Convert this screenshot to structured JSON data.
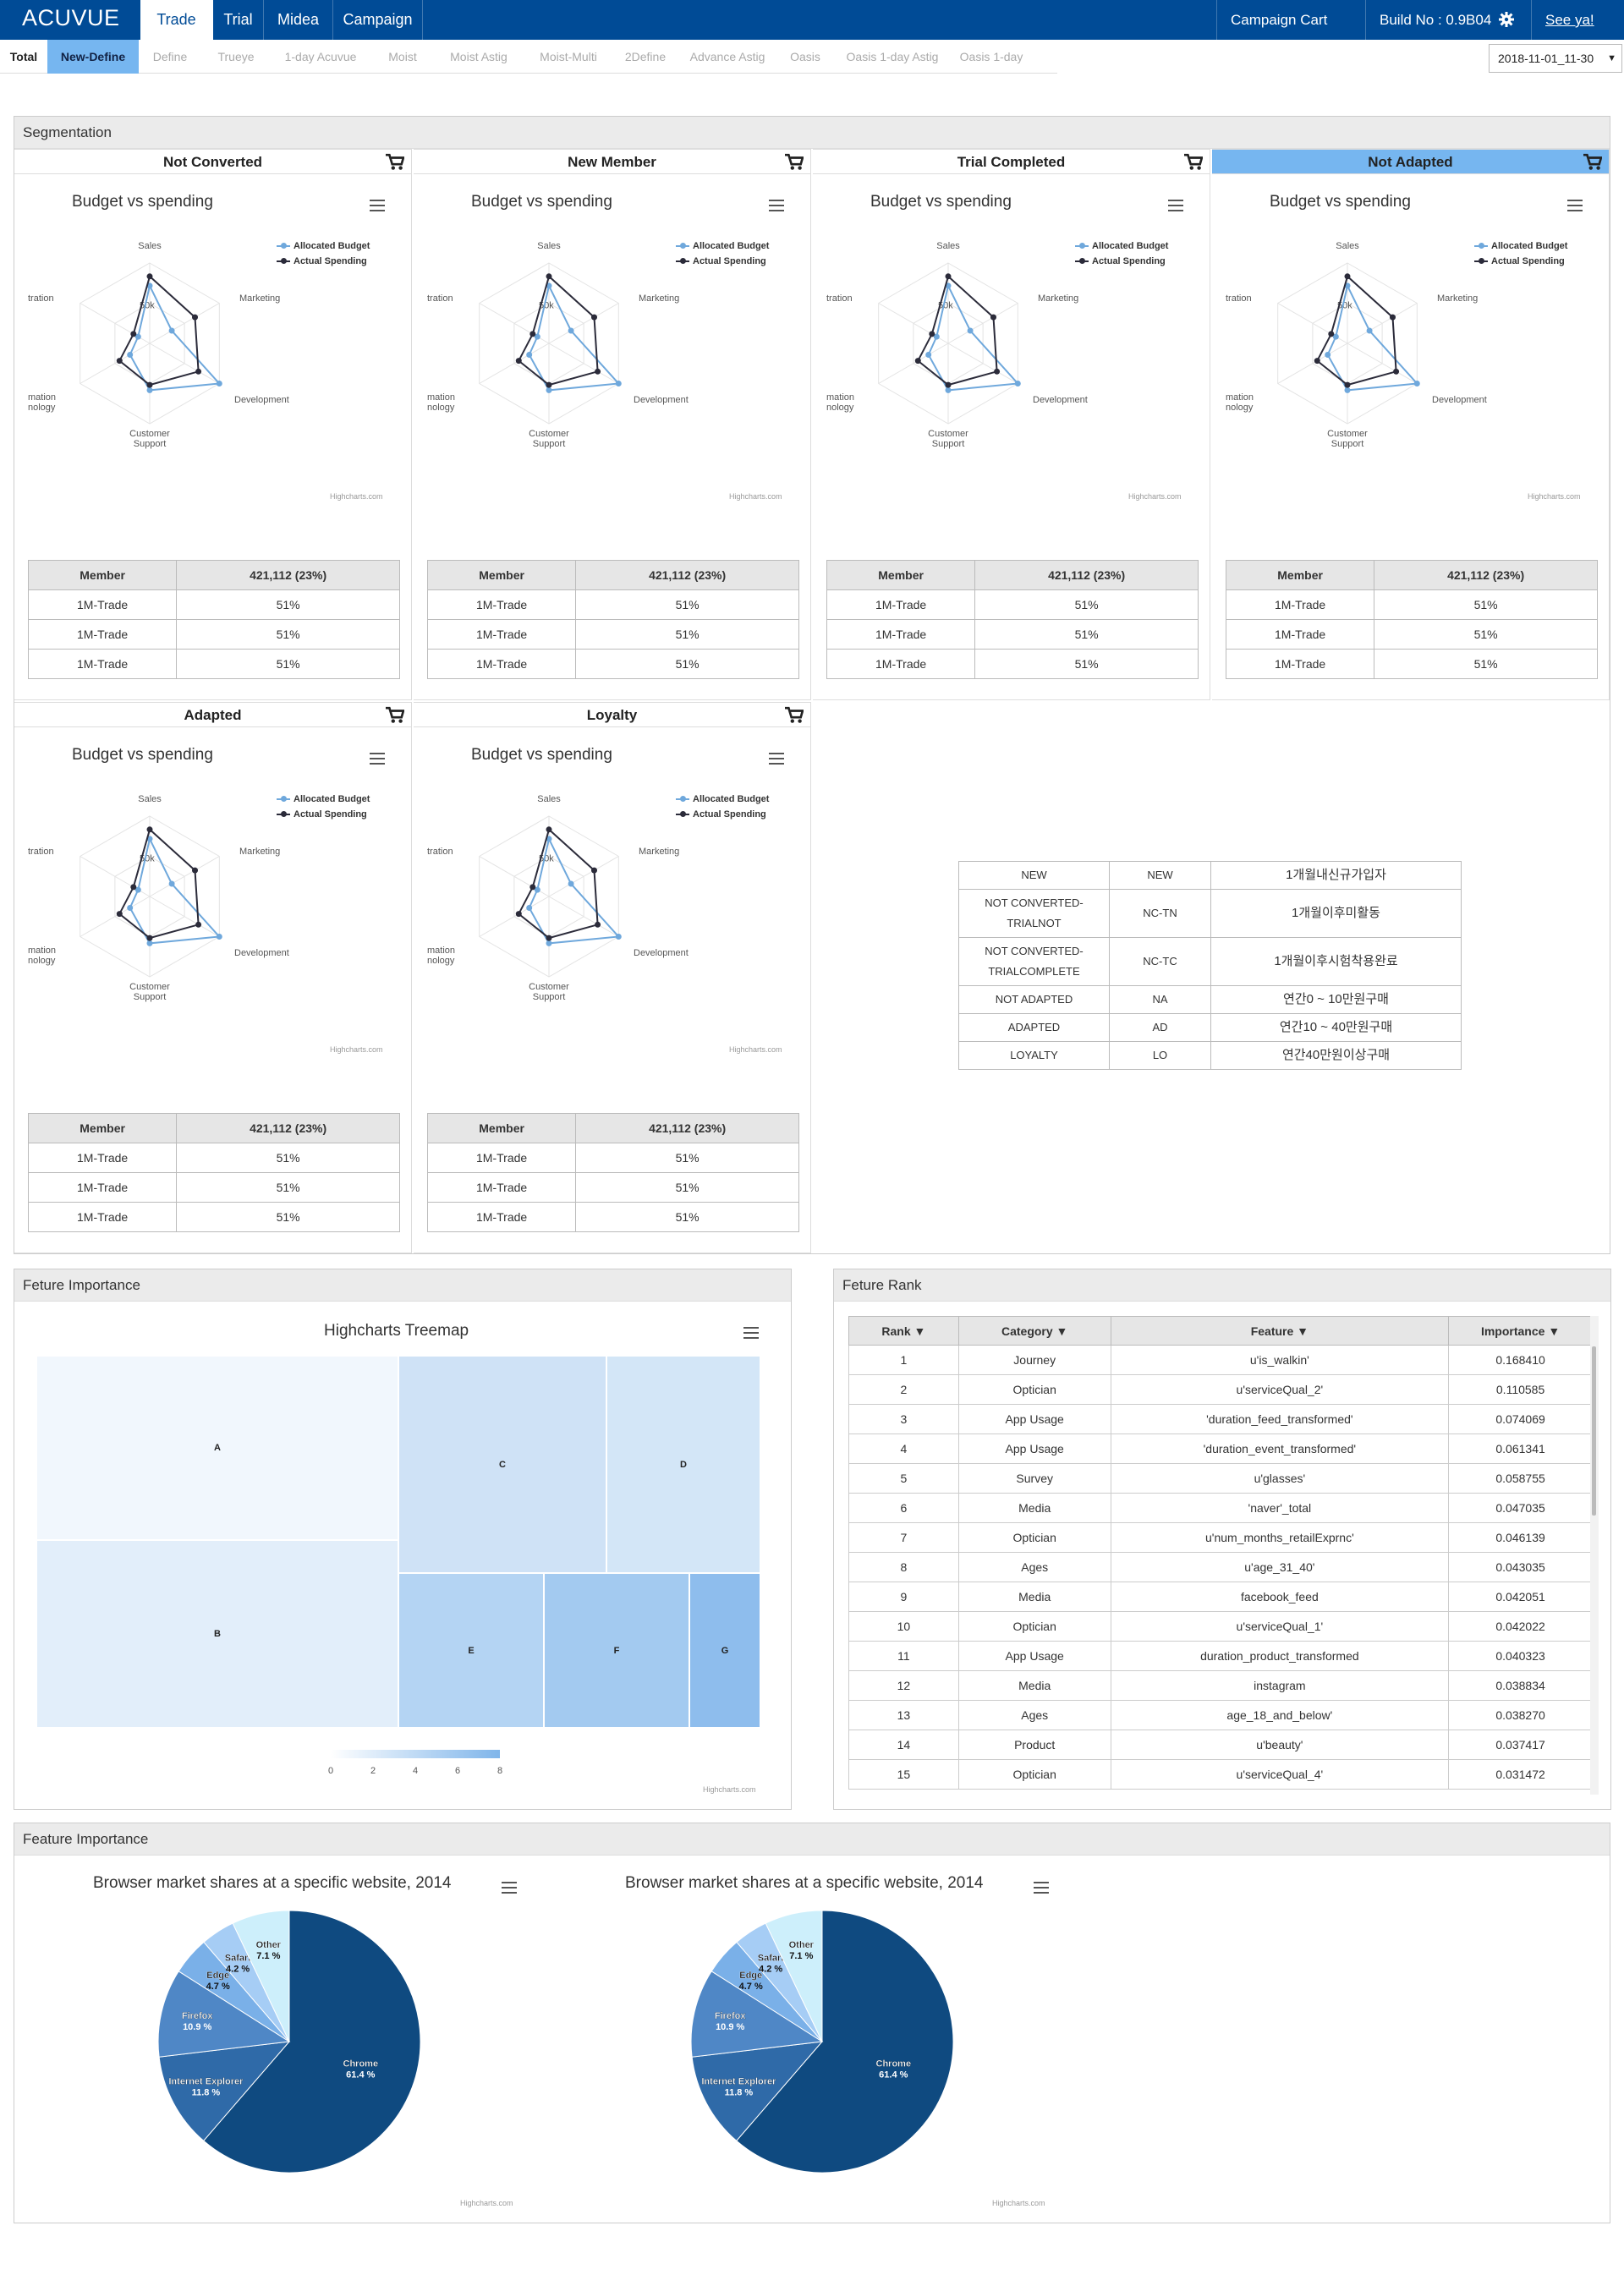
{
  "app": {
    "logo": "ACUVUE",
    "tabs": [
      "Trade",
      "Trial",
      "Midea",
      "Campaign"
    ],
    "active_tab": "Trade",
    "campaign_cart": "Campaign Cart",
    "build": "Build No : 0.9B04",
    "user": "See ya!"
  },
  "subnav": {
    "items": [
      "Total",
      "New-Define",
      "Define",
      "Trueye",
      "1-day Acuvue",
      "Moist",
      "Moist Astig",
      "Moist-Multi",
      "2Define",
      "Advance Astig",
      "Oasis",
      "Oasis 1-day Astig",
      "Oasis 1-day"
    ],
    "active": "New-Define",
    "date": "2018-11-01_11-30"
  },
  "segmentation": {
    "title": "Segmentation",
    "chart_title": "Budget vs spending",
    "legend": [
      "Allocated Budget",
      "Actual Spending"
    ],
    "axes": [
      "Sales",
      "Marketing",
      "Development",
      "Customer Support",
      "Information Technology",
      "Administration"
    ],
    "axis_label_lines": {
      "sales": "Sales",
      "marketing": "Marketing",
      "development": "Development",
      "cs1": "Customer",
      "cs2": "Support",
      "it1": "mation",
      "it2": "nology",
      "admin": "tration"
    },
    "tick": "50k",
    "credits": "Highcharts.com",
    "table_header": [
      "Member",
      "421,112 (23%)"
    ],
    "table_rows": [
      [
        "1M-Trade",
        "51%"
      ],
      [
        "1M-Trade",
        "51%"
      ],
      [
        "1M-Trade",
        "51%"
      ]
    ],
    "segments": [
      {
        "name": "Not Converted",
        "selected": false
      },
      {
        "name": "New Member",
        "selected": false
      },
      {
        "name": "Trial Completed",
        "selected": false
      },
      {
        "name": "Not Adapted",
        "selected": true
      },
      {
        "name": "Adapted",
        "selected": false
      },
      {
        "name": "Loyalty",
        "selected": false
      }
    ],
    "codes": [
      [
        "NEW",
        "NEW",
        "1개월내신규가입자"
      ],
      [
        "NOT CONVERTED-\nTRIALNOT",
        "NC-TN",
        "1개월이후미활동"
      ],
      [
        "NOT CONVERTED-\nTRIALCOMPLETE",
        "NC-TC",
        "1개월이후시험착용완료"
      ],
      [
        "NOT ADAPTED",
        "NA",
        "연간0 ~ 10만원구매"
      ],
      [
        "ADAPTED",
        "AD",
        "연간10 ~ 40만원구매"
      ],
      [
        "LOYALTY",
        "LO",
        "연간40만원이상구매"
      ]
    ]
  },
  "chart_data": [
    {
      "type": "radar",
      "title": "Budget vs spending",
      "categories": [
        "Sales",
        "Marketing",
        "Development",
        "Customer Support",
        "Information Technology",
        "Administration"
      ],
      "series": [
        {
          "name": "Allocated Budget",
          "values": [
            43000,
            19000,
            60000,
            35000,
            17000,
            10000
          ]
        },
        {
          "name": "Actual Spending",
          "values": [
            50000,
            39000,
            42000,
            31000,
            26000,
            14000
          ]
        }
      ],
      "yticks": [
        "50k"
      ]
    },
    {
      "type": "heatmap",
      "title": "Highcharts Treemap",
      "labels": [
        "A",
        "B",
        "C",
        "D",
        "E",
        "F",
        "G"
      ],
      "values": [
        1,
        2,
        4,
        3,
        5,
        6,
        7
      ],
      "color_axis": [
        0,
        2,
        4,
        6,
        8
      ]
    },
    {
      "type": "pie",
      "title": "Browser market shares at a specific website, 2014",
      "categories": [
        "Chrome",
        "Internet Explorer",
        "Firefox",
        "Edge",
        "Safari",
        "Other"
      ],
      "values": [
        61.4,
        11.8,
        10.9,
        4.7,
        4.2,
        7.1
      ]
    }
  ],
  "feature_importance": {
    "title": "Feture Importance",
    "treemap_title": "Highcharts Treemap",
    "axis_ticks": [
      "0",
      "2",
      "4",
      "6",
      "8"
    ],
    "credits": "Highcharts.com"
  },
  "feature_rank": {
    "title": "Feture Rank",
    "columns": [
      "Rank ▼",
      "Category ▼",
      "Feature ▼",
      "Importance ▼"
    ],
    "rows": [
      [
        "1",
        "Journey",
        "u'is_walkin'",
        "0.168410"
      ],
      [
        "2",
        "Optician",
        "u'serviceQual_2'",
        "0.110585"
      ],
      [
        "3",
        "App Usage",
        "'duration_feed_transformed'",
        "0.074069"
      ],
      [
        "4",
        "App Usage",
        "'duration_event_transformed'",
        "0.061341"
      ],
      [
        "5",
        "Survey",
        "u'glasses'",
        "0.058755"
      ],
      [
        "6",
        "Media",
        "'naver'_total",
        "0.047035"
      ],
      [
        "7",
        "Optician",
        "u'num_months_retailExprnc'",
        "0.046139"
      ],
      [
        "8",
        "Ages",
        "u'age_31_40'",
        "0.043035"
      ],
      [
        "9",
        "Media",
        "facebook_feed",
        "0.042051"
      ],
      [
        "10",
        "Optician",
        "u'serviceQual_1'",
        "0.042022"
      ],
      [
        "11",
        "App Usage",
        "duration_product_transformed",
        "0.040323"
      ],
      [
        "12",
        "Media",
        "instagram",
        "0.038834"
      ],
      [
        "13",
        "Ages",
        "age_18_and_below'",
        "0.038270"
      ],
      [
        "14",
        "Product",
        "u'beauty'",
        "0.037417"
      ],
      [
        "15",
        "Optician",
        "u'serviceQual_4'",
        "0.031472"
      ]
    ]
  },
  "browser": {
    "panel_title": "Feature Importance",
    "chart_title": "Browser market shares at a specific website, 2014",
    "credits": "Highcharts.com",
    "slices": [
      {
        "name": "Chrome",
        "pct": "61.4 %",
        "value": 61.4,
        "color": "#0f4a80"
      },
      {
        "name": "Internet Explorer",
        "pct": "11.8 %",
        "value": 11.8,
        "color": "#2f6aa8"
      },
      {
        "name": "Firefox",
        "pct": "10.9 %",
        "value": 10.9,
        "color": "#4f87c6"
      },
      {
        "name": "Edge",
        "pct": "4.7 %",
        "value": 4.7,
        "color": "#7ab0e8"
      },
      {
        "name": "Safari",
        "pct": "4.2 %",
        "value": 4.2,
        "color": "#a6cdf5"
      },
      {
        "name": "Other",
        "pct": "7.1 %",
        "value": 7.1,
        "color": "#cdeffb"
      }
    ]
  },
  "colors": {
    "brand": "#004b96",
    "accent": "#76b6f0",
    "allocated": "#6fa8dc",
    "actual": "#2b2b3a"
  }
}
